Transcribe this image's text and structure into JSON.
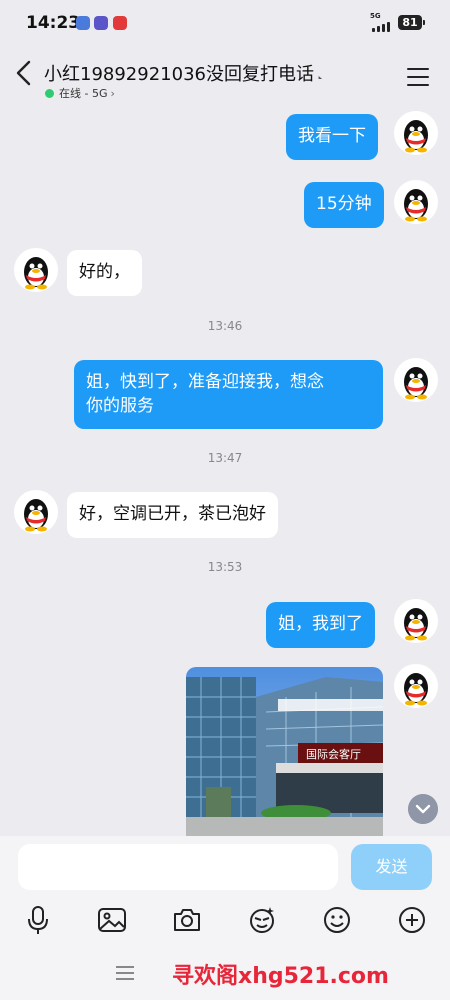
{
  "status_bar": {
    "time": "14:23",
    "network": "5G",
    "battery": "81",
    "app_icons": [
      "vivo-store-icon",
      "shield-app-icon",
      "red-app-icon"
    ]
  },
  "header": {
    "title": "小红19892921036没回复打电话",
    "ear_icon": "earpiece-icon",
    "status": "在线 - 5G",
    "status_color": "#2ecc71"
  },
  "messages": [
    {
      "side": "out",
      "text": "我看一下"
    },
    {
      "side": "out",
      "text": "15分钟"
    },
    {
      "side": "in",
      "text": "好的，"
    },
    {
      "side": "time",
      "text": "13:46"
    },
    {
      "side": "out",
      "text_line1": "姐，快到了，准备迎接我，想念",
      "text_line2": "你的服务"
    },
    {
      "side": "time",
      "text": "13:47"
    },
    {
      "side": "in",
      "text": "好，空调已开，茶已泡好"
    },
    {
      "side": "time",
      "text": "13:53"
    },
    {
      "side": "out",
      "text": "姐，我到了"
    },
    {
      "side": "out",
      "type": "image",
      "sign_text": "国际会客厅"
    }
  ],
  "input": {
    "placeholder": "",
    "send_label": "发送"
  },
  "toolbar": [
    "microphone-icon",
    "image-icon",
    "camera-icon",
    "sticker-icon",
    "emoji-icon",
    "plus-icon"
  ],
  "watermark": "寻欢阁xhg521.com",
  "colors": {
    "accent": "#1e9bf7",
    "send_disabled": "#8fd0fa",
    "background": "#ececf0"
  }
}
